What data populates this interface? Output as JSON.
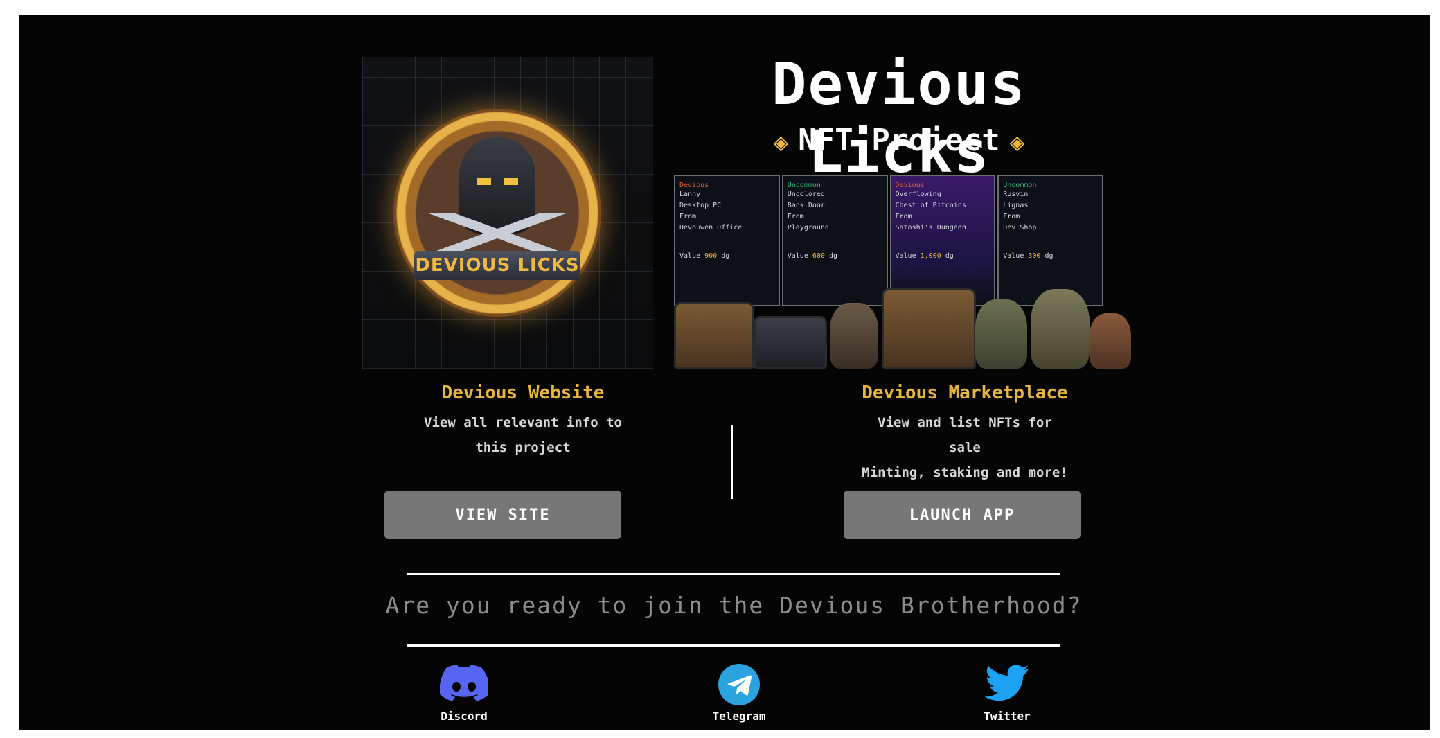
{
  "hero": {
    "title": "Devious Licks",
    "subtitle": "NFT Project",
    "emblem_text": "DEVIOUS LICKS",
    "cards": [
      {
        "rarity": "Devious",
        "rarity_color": "#e06030",
        "lines": [
          "Lanny",
          "Desktop PC",
          "From",
          "Devouwen Office"
        ],
        "value_label": "Value",
        "value": "900",
        "unit": "dg",
        "style": "dark"
      },
      {
        "rarity": "Uncommon",
        "rarity_color": "#30c080",
        "lines": [
          "Uncolored",
          "Back Door",
          "From",
          "Playground"
        ],
        "value_label": "Value",
        "value": "600",
        "unit": "dg",
        "style": "dark"
      },
      {
        "rarity": "Devious",
        "rarity_color": "#e06030",
        "lines": [
          "Overflowing",
          "Chest of Bitcoins",
          "From",
          "Satoshi's Dungeon"
        ],
        "value_label": "Value",
        "value": "1,000",
        "unit": "dg",
        "style": "purple"
      },
      {
        "rarity": "Uncommon",
        "rarity_color": "#30c080",
        "lines": [
          "Rusvin",
          "Lignas",
          "From",
          "Dev Shop"
        ],
        "value_label": "Value",
        "value": "300",
        "unit": "dg",
        "style": "dark"
      }
    ]
  },
  "website": {
    "title": "Devious Website",
    "desc_line1": "View all relevant info to",
    "desc_line2": "this project",
    "button": "VIEW SITE"
  },
  "marketplace": {
    "title": "Devious Marketplace",
    "desc_line1": "View and list NFTs for",
    "desc_line2": "sale",
    "desc_line3": "Minting, staking and more!",
    "button": "LAUNCH APP"
  },
  "tagline": "Are you ready to join the Devious Brotherhood?",
  "socials": [
    {
      "label": "Discord",
      "icon": "discord-icon",
      "color": "#5865f2"
    },
    {
      "label": "Telegram",
      "icon": "telegram-icon",
      "color": "#2aa3e0"
    },
    {
      "label": "Twitter",
      "icon": "twitter-icon",
      "color": "#1da1f2"
    }
  ],
  "colors": {
    "accent": "#e8b640",
    "background": "#050505",
    "button": "#777777"
  }
}
